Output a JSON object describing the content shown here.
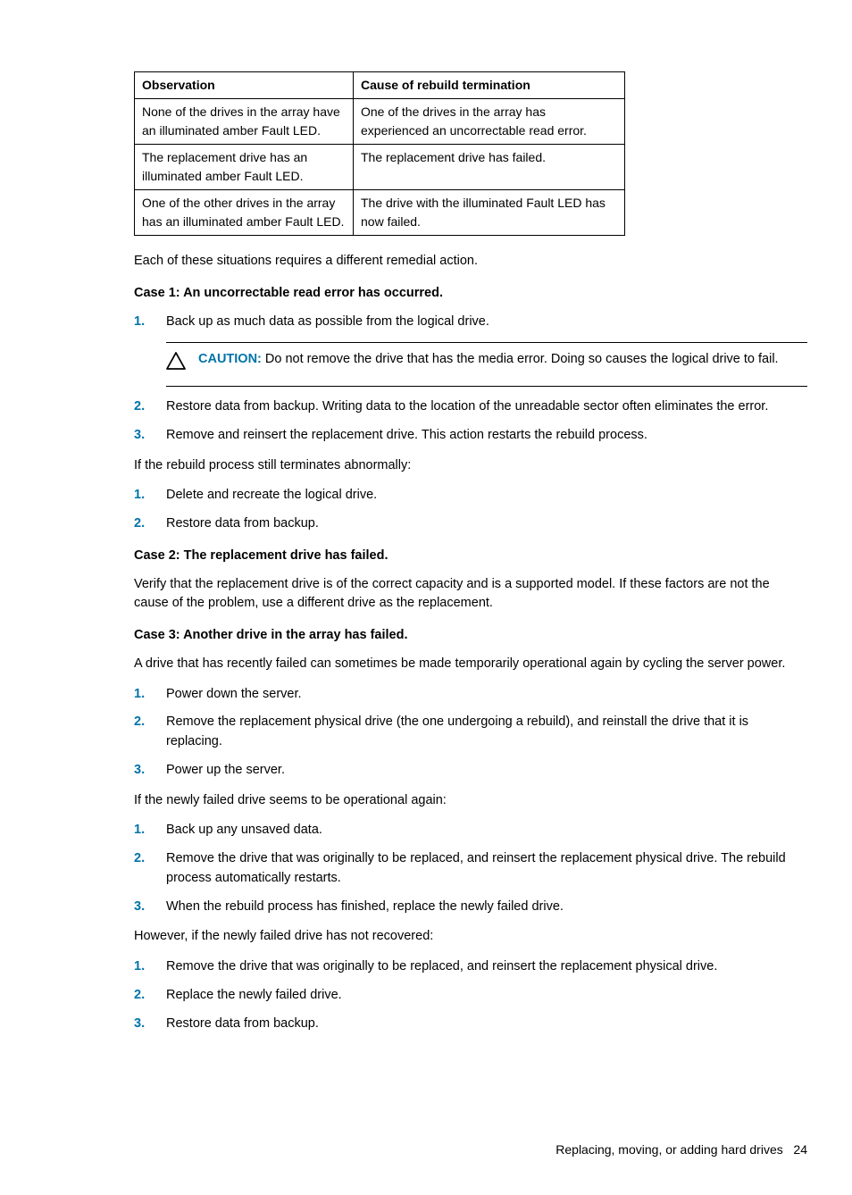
{
  "table": {
    "headers": [
      "Observation",
      "Cause of rebuild termination"
    ],
    "rows": [
      [
        "None of the drives in the array have an illuminated amber Fault LED.",
        "One of the drives in the array has experienced an uncorrectable read error."
      ],
      [
        "The replacement drive has an illuminated amber Fault LED.",
        "The replacement drive has failed."
      ],
      [
        "One of the other drives in the array has an illuminated amber Fault LED.",
        "The drive with the illuminated Fault LED has now failed."
      ]
    ]
  },
  "intro": "Each of these situations requires a different remedial action.",
  "case1": {
    "title": "Case 1: An uncorrectable read error has occurred.",
    "step1": "Back up as much data as possible from the logical drive.",
    "caution_label": "CAUTION:",
    "caution_text": "Do not remove the drive that has the media error. Doing so causes the logical drive to fail.",
    "step2": "Restore data from backup. Writing data to the location of the unreadable sector often eliminates the error.",
    "step3": "Remove and reinsert the replacement drive. This action restarts the rebuild process.",
    "iftext": "If the rebuild process still terminates abnormally:",
    "ifstep1": "Delete and recreate the logical drive.",
    "ifstep2": "Restore data from backup."
  },
  "case2": {
    "title": "Case 2: The replacement drive has failed.",
    "text": "Verify that the replacement drive is of the correct capacity and is a supported model. If these factors are not the cause of the problem, use a different drive as the replacement."
  },
  "case3": {
    "title": "Case 3: Another drive in the array has failed.",
    "text": "A drive that has recently failed can sometimes be made temporarily operational again by cycling the server power.",
    "step1": "Power down the server.",
    "step2": "Remove the replacement physical drive (the one undergoing a rebuild), and reinstall the drive that it is replacing.",
    "step3": "Power up the server.",
    "iftext": "If the newly failed drive seems to be operational again:",
    "ifstep1": "Back up any unsaved data.",
    "ifstep2": "Remove the drive that was originally to be replaced, and reinsert the replacement physical drive. The rebuild process automatically restarts.",
    "ifstep3": "When the rebuild process has finished, replace the newly failed drive.",
    "however": "However, if the newly failed drive has not recovered:",
    "hstep1": "Remove the drive that was originally to be replaced, and reinsert the replacement physical drive.",
    "hstep2": "Replace the newly failed drive.",
    "hstep3": "Restore data from backup."
  },
  "footer": {
    "text": "Replacing, moving, or adding hard drives",
    "page": "24"
  },
  "nums": {
    "n1": "1.",
    "n2": "2.",
    "n3": "3."
  }
}
